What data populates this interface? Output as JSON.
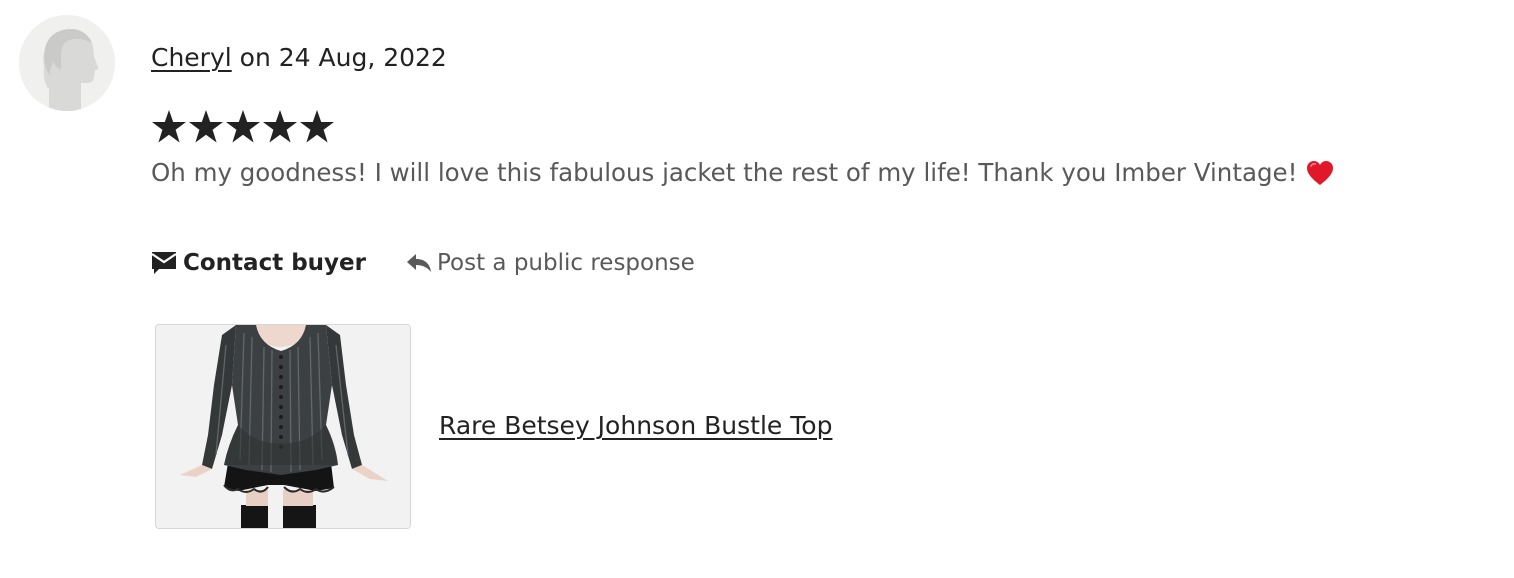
{
  "review": {
    "reviewer_name": "Cheryl",
    "date_text": "on 24 Aug, 2022",
    "rating": 5,
    "rating_max": 5,
    "text": "Oh my goodness! I will love this fabulous jacket the rest of my life! Thank you Imber Vintage!",
    "emoji": "heart-emoji"
  },
  "actions": {
    "contact_label": "Contact buyer",
    "contact_icon": "message-icon",
    "response_label": "Post a public response",
    "response_icon": "reply-arrow-icon"
  },
  "listing": {
    "title": "Rare Betsey Johnson Bustle Top",
    "image": "listing-thumbnail"
  },
  "colors": {
    "star": "#222222",
    "heart": "#e0182a",
    "muted_text": "#595959",
    "primary_text": "#222222"
  }
}
